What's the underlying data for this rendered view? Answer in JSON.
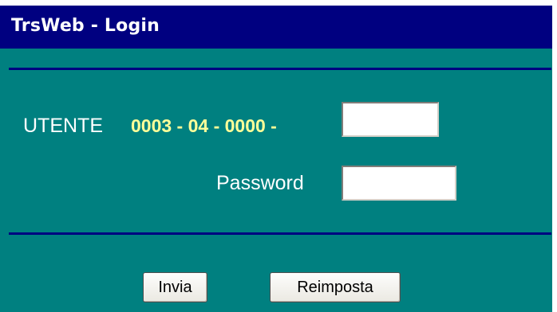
{
  "window": {
    "title": "TrsWeb - Login"
  },
  "form": {
    "utente_label": "UTENTE",
    "utente_prefix": "0003 - 04 - 0000 -",
    "utente_value": "",
    "password_label": "Password",
    "password_value": ""
  },
  "buttons": {
    "submit_label": "Invia",
    "reset_label": "Reimposta"
  },
  "colors": {
    "title_bar": "#000080",
    "panel": "#008080",
    "prefix_text": "#ffff99",
    "label_text": "#ffffff"
  }
}
